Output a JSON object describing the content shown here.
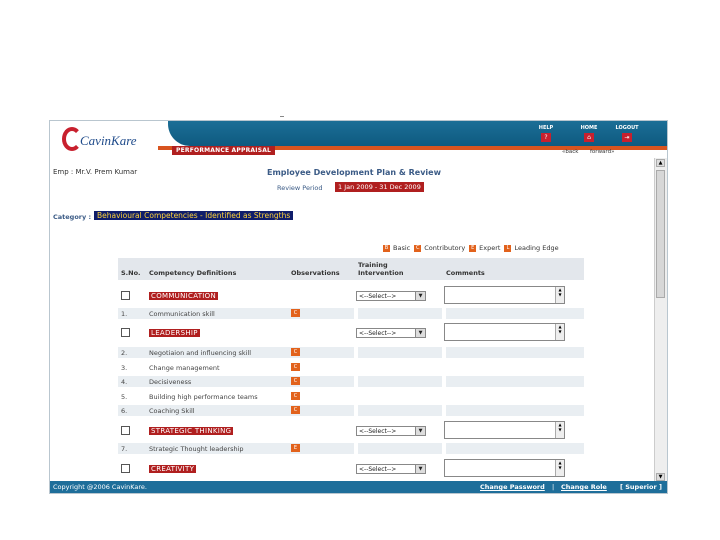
{
  "header": {
    "logo_text": "CavinKare",
    "app_title": "PERFORMANCE APPRAISAL",
    "nav": [
      {
        "label": "HELP",
        "icon": "help-icon",
        "glyph": "?"
      },
      {
        "label": "HOME",
        "icon": "home-icon",
        "glyph": "⌂"
      },
      {
        "label": "LOGOUT",
        "icon": "logout-icon",
        "glyph": "⇥"
      }
    ],
    "back": "«back",
    "forward": "forward»"
  },
  "page": {
    "employee": "Emp : Mr.V. Prem Kumar",
    "title": "Employee Development Plan & Review",
    "review_period_label": "Review Period",
    "review_period": "1 Jan 2009 - 31 Dec 2009",
    "category_label": "Category :",
    "category": "Behavioural Competencies - Identified as Strengths"
  },
  "legend": [
    {
      "code": "B",
      "label": "Basic"
    },
    {
      "code": "C",
      "label": "Contributory"
    },
    {
      "code": "E",
      "label": "Expert"
    },
    {
      "code": "L",
      "label": "Leading Edge"
    }
  ],
  "table": {
    "headers": {
      "sno": "S.No.",
      "competency": "Competency Definitions",
      "observations": "Observations",
      "training": "Training Intervention",
      "comments": "Comments"
    },
    "select_value": "<--Select-->",
    "groups": [
      {
        "name": "COMMUNICATION"
      },
      {
        "name": "LEADERSHIP"
      },
      {
        "name": "STRATEGIC THINKING"
      },
      {
        "name": "CREATIVITY"
      }
    ],
    "rows": [
      {
        "sno": "1.",
        "competency": "Communication skill",
        "obs": "C"
      },
      {
        "sno": "2.",
        "competency": "Negotiaion and influencing skill",
        "obs": "C"
      },
      {
        "sno": "3.",
        "competency": "Change management",
        "obs": "C"
      },
      {
        "sno": "4.",
        "competency": "Decisiveness",
        "obs": "C"
      },
      {
        "sno": "5.",
        "competency": "Building high performance teams",
        "obs": "C"
      },
      {
        "sno": "6.",
        "competency": "Coaching Skill",
        "obs": "C"
      },
      {
        "sno": "7.",
        "competency": "Strategic Thought leadership",
        "obs": "E"
      }
    ]
  },
  "footer": {
    "copyright": "Copyright @2006 CavinKare.",
    "change_password": "Change Password",
    "separator": "|",
    "change_role": "Change Role",
    "role": "[ Superior ]"
  },
  "colors": {
    "brand_blue": "#1c6e96",
    "brand_red": "#b01f1f",
    "accent_orange": "#e2621c",
    "category_bg": "#0f1d6b"
  }
}
